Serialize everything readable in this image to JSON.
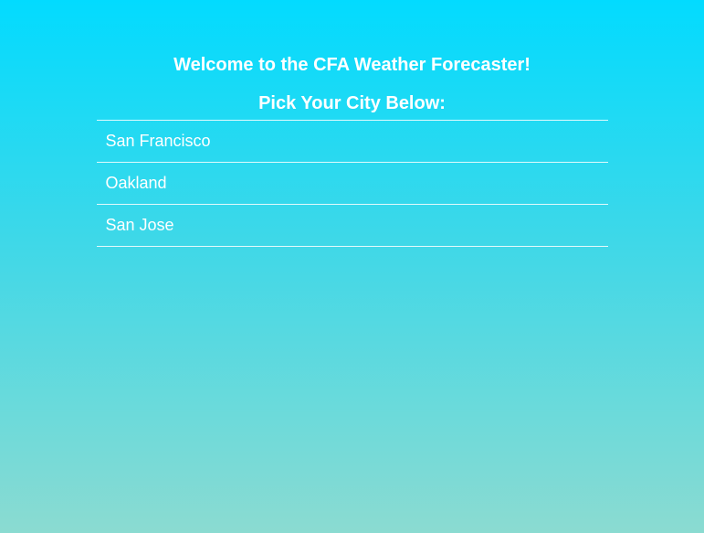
{
  "header": {
    "welcome": "Welcome to the CFA Weather Forecaster!",
    "prompt": "Pick Your City Below:"
  },
  "cities": [
    {
      "label": "San Francisco"
    },
    {
      "label": "Oakland"
    },
    {
      "label": "San Jose"
    }
  ],
  "colors": {
    "gradient_top": "#02dbff",
    "gradient_bottom": "#8bdbd1",
    "text": "#ffffff"
  }
}
